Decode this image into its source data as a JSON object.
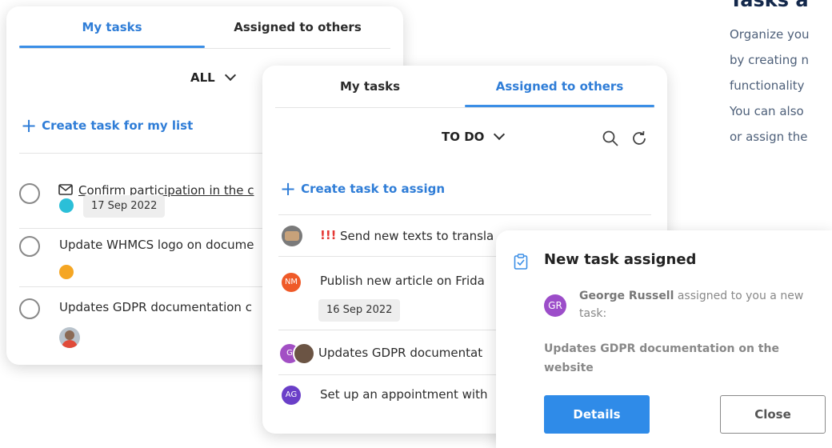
{
  "section": {
    "title": "Tasks a",
    "description_lines": [
      "Organize you",
      "by creating n",
      "functionality",
      "You can also",
      "or assign the"
    ]
  },
  "card1": {
    "tabs": [
      "My tasks",
      "Assigned to others"
    ],
    "filter": "ALL",
    "create_label": "Create task for my list",
    "tasks": [
      {
        "title": "Confirm participation in the c",
        "date": "17 Sep 2022",
        "color": "#2bbfd8"
      },
      {
        "title": "Update WHMCS logo on docume",
        "color": "#f5a623"
      },
      {
        "title": "Updates GDPR documentation c"
      }
    ]
  },
  "card2": {
    "tabs": [
      "My tasks",
      "Assigned to others"
    ],
    "filter": "TO DO",
    "create_label": "Create task to assign",
    "tasks": [
      {
        "priority": "!!!",
        "title": "Send new texts to transla"
      },
      {
        "avatar": "NM",
        "avatar_color": "#ef5a28",
        "title": "Publish new article on Frida",
        "date": "16 Sep 2022"
      },
      {
        "avatar": "G",
        "avatar_color": "#a24fc4",
        "title": "Updates GDPR documentat"
      },
      {
        "avatar": "AG",
        "avatar_color": "#6a3fc8",
        "title": "Set up an appointment with"
      }
    ]
  },
  "notification": {
    "title": "New task assigned",
    "avatar": "GR",
    "avatar_color": "#9c4dc9",
    "sender": "George Russell",
    "message_line1": " assigned to you a new",
    "message_line2": "task:",
    "task_line1": "Updates GDPR documentation on the",
    "task_line2": "website",
    "details_label": "Details",
    "close_label": "Close"
  }
}
